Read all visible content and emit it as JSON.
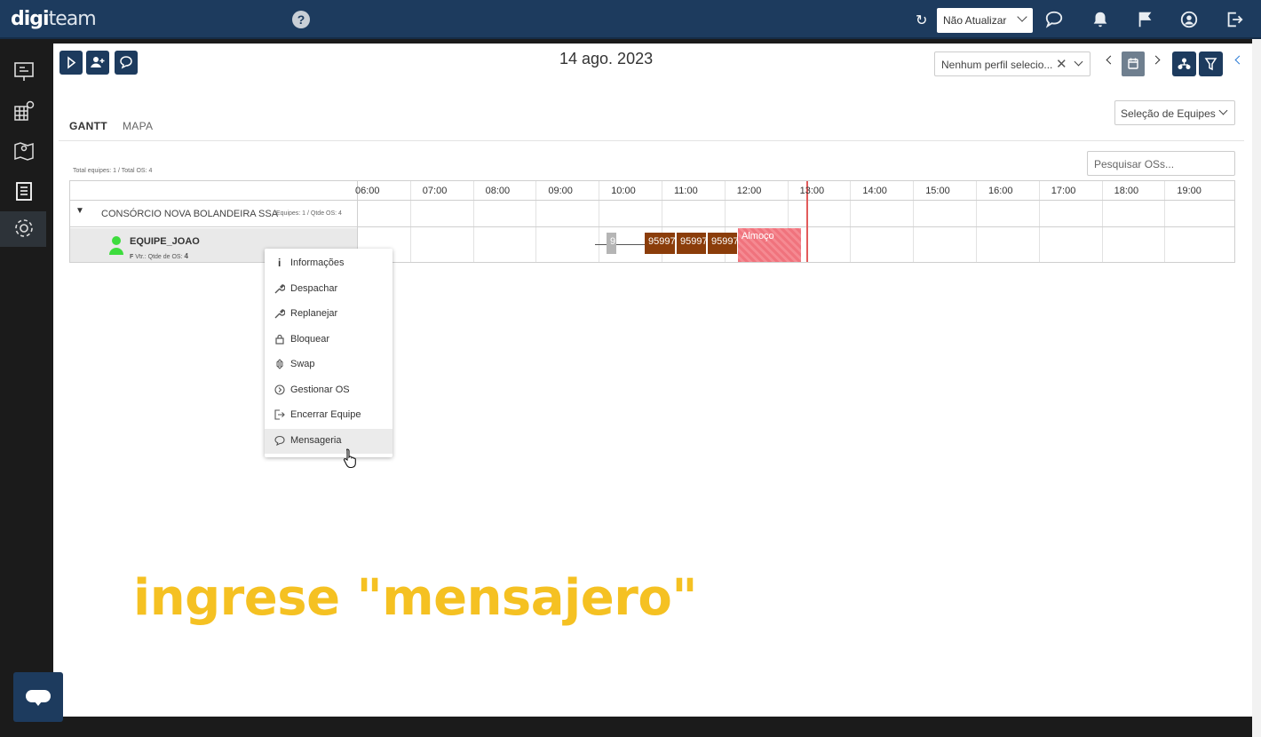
{
  "app": {
    "logo_bold": "digi",
    "logo_rest": "team"
  },
  "topbar": {
    "help_icon": "question-circle-icon",
    "update_select": "Não Atualizar",
    "icons": [
      "refresh-icon",
      "chat-icon",
      "bell-icon",
      "flag-icon",
      "user-circle-icon",
      "logout-icon"
    ]
  },
  "toolbar": {
    "date": "14 ago. 2023",
    "profile_placeholder": "Nenhum perfil selecio...",
    "profile_clear": "✕"
  },
  "tabs": [
    {
      "label": "GANTT"
    },
    {
      "label": "MAPA"
    }
  ],
  "filters": {
    "equipe_select": "Seleção de Equipes",
    "search_placeholder": "Pesquisar OSs..."
  },
  "totals": "Total equipes: 1 / Total OS: 4",
  "gantt": {
    "hours": [
      "06:00",
      "07:00",
      "08:00",
      "09:00",
      "10:00",
      "11:00",
      "12:00",
      "13:00",
      "14:00",
      "15:00",
      "16:00",
      "17:00",
      "18:00",
      "19:00"
    ],
    "group": {
      "name": "CONSÓRCIO NOVA BOLANDEIRA SSA",
      "meta": "Equipes: 1 / Qtde OS: 4"
    },
    "team": {
      "name": "EQUIPE_JOAO",
      "meta_prefix": "F",
      "meta_label": "Vtr.: Qtde de OS:",
      "meta_count": "4"
    },
    "bars": [
      {
        "label": "9",
        "kind": "pending"
      },
      {
        "label": "95997",
        "kind": "os"
      },
      {
        "label": "95997",
        "kind": "os"
      },
      {
        "label": "95997",
        "kind": "os"
      },
      {
        "label": "Almoço",
        "kind": "lunch"
      }
    ],
    "current_time": "13:00"
  },
  "context_menu": [
    {
      "label": "Informações",
      "icon": "info-icon"
    },
    {
      "label": "Despachar",
      "icon": "wrench-icon"
    },
    {
      "label": "Replanejar",
      "icon": "wrench-icon"
    },
    {
      "label": "Bloquear",
      "icon": "lock-icon"
    },
    {
      "label": "Swap",
      "icon": "swap-icon"
    },
    {
      "label": "Gestionar OS",
      "icon": "circle-arrow-icon"
    },
    {
      "label": "Encerrar Equipe",
      "icon": "exit-icon"
    },
    {
      "label": "Mensageria",
      "icon": "message-icon"
    }
  ],
  "caption": "ingrese \"mensajero\"",
  "colors": {
    "navy": "#1d3b5e",
    "os_bar": "#8b3d0a",
    "lunch": "#f0737d",
    "caption": "#f5c122",
    "now_line": "#e25b5b"
  }
}
